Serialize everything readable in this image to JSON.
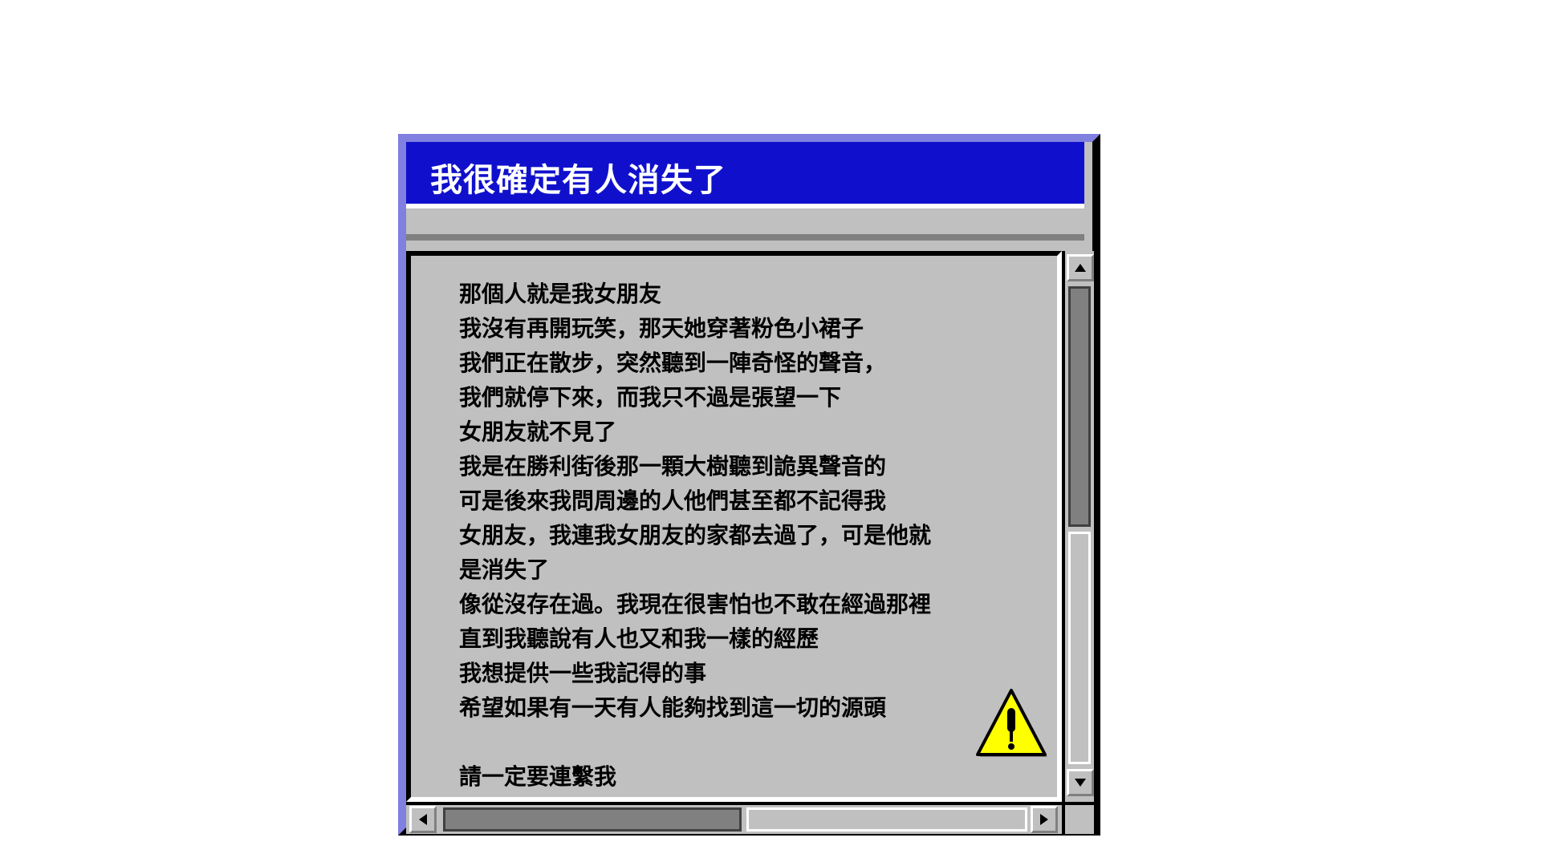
{
  "window": {
    "title": "我很確定有人消失了"
  },
  "message": {
    "lines": [
      "那個人就是我女朋友",
      "我沒有再開玩笑，那天她穿著粉色小裙子",
      "我們正在散步，突然聽到一陣奇怪的聲音，",
      "我們就停下來，而我只不過是張望一下",
      "女朋友就不見了",
      "我是在勝利街後那一顆大樹聽到詭異聲音的",
      "可是後來我問周邊的人他們甚至都不記得我",
      "女朋友，我連我女朋友的家都去過了，可是他就",
      "是消失了",
      "像從沒存在過。我現在很害怕也不敢在經過那裡",
      "直到我聽說有人也又和我一樣的經歷",
      "我想提供一些我記得的事",
      "希望如果有一天有人能夠找到這一切的源頭",
      "",
      "請一定要連繫我"
    ]
  },
  "icons": {
    "warning": "warning-icon",
    "scroll_up": "arrow-up-icon",
    "scroll_down": "arrow-down-icon",
    "scroll_left": "arrow-left-icon",
    "scroll_right": "arrow-right-icon"
  },
  "colors": {
    "titlebar": "#1010cc",
    "window_face": "#c0c0c0",
    "warning_fill": "#ffff00"
  },
  "scroll": {
    "vertical_position": 0.0,
    "horizontal_position": 0.0
  }
}
